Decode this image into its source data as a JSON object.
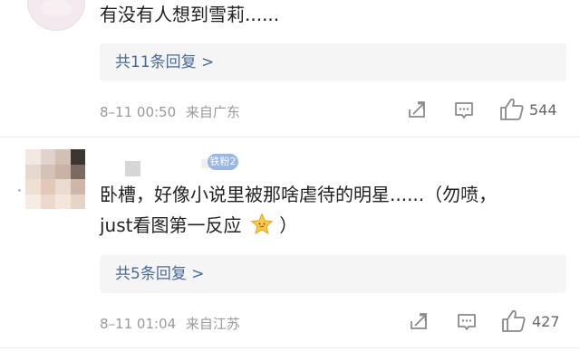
{
  "comments": [
    {
      "text": "有没有人想到雪莉......",
      "replies_label": "共11条回复 >",
      "date": "8–11 00:50",
      "location": "来自广东",
      "likes": "544"
    },
    {
      "fan_badge": "铁粉2",
      "text_line1": "卧槽，好像小说里被那啥虐待的明星......（勿喷，",
      "text_line2": "just看图第一反应",
      "replies_label": "共5条回复 >",
      "date": "8–11 01:04",
      "location": "来自江苏",
      "likes": "427"
    }
  ],
  "icons": {
    "share": "share-icon",
    "comment": "comment-icon",
    "like": "thumbs-up-icon",
    "emoji": "star-face-emoji"
  },
  "colors": {
    "link": "#4a6a95",
    "meta": "#9a9a9a",
    "reply_box": "#f5f5f5",
    "fan_badge": "#9ab6e3"
  }
}
